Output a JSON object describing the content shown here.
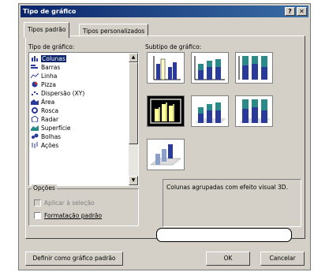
{
  "window": {
    "title": "Tipo de gráfico",
    "help_label": "?",
    "close_label": "✕"
  },
  "tabs": [
    {
      "label": "Tipos padrão",
      "active": true
    },
    {
      "label": "Tipos personalizados",
      "active": false
    }
  ],
  "chart_type": {
    "label": "Tipo de gráfico:",
    "items": [
      {
        "label": "Colunas",
        "icon": "column-chart-icon",
        "selected": true
      },
      {
        "label": "Barras",
        "icon": "bar-chart-icon"
      },
      {
        "label": "Linha",
        "icon": "line-chart-icon"
      },
      {
        "label": "Pizza",
        "icon": "pie-chart-icon"
      },
      {
        "label": "Dispersão (XY)",
        "icon": "scatter-chart-icon"
      },
      {
        "label": "Área",
        "icon": "area-chart-icon"
      },
      {
        "label": "Rosca",
        "icon": "doughnut-chart-icon"
      },
      {
        "label": "Radar",
        "icon": "radar-chart-icon"
      },
      {
        "label": "Superfície",
        "icon": "surface-chart-icon"
      },
      {
        "label": "Bolhas",
        "icon": "bubble-chart-icon"
      },
      {
        "label": "Ações",
        "icon": "stock-chart-icon"
      }
    ]
  },
  "options": {
    "label": "Opções",
    "apply_selection": {
      "label": "Aplicar à seleção",
      "checked": false,
      "disabled": true
    },
    "default_format": {
      "label": "Formatação padrão",
      "checked": false
    }
  },
  "subtype": {
    "label": "Subtipo de gráfico:",
    "description": "Colunas agrupadas com efeito visual 3D."
  },
  "buttons": {
    "set_default": "Definir como gráfico padrão",
    "ok": "OK",
    "cancel": "Cancelar"
  },
  "colors": {
    "selection": "#0a246a",
    "bar_blue": "#2a3a9a",
    "bar_teal": "#2a8a8a",
    "bar_yellow": "#ffff99"
  }
}
